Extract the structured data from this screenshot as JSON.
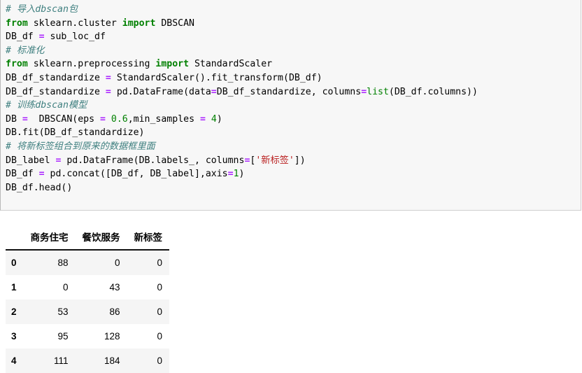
{
  "cell": {
    "code_lines": [
      [
        {
          "t": "comment",
          "s": "# 导入dbscan包"
        }
      ],
      [
        {
          "t": "kw",
          "s": "from"
        },
        {
          "t": "plain",
          "s": " sklearn.cluster "
        },
        {
          "t": "kw",
          "s": "import"
        },
        {
          "t": "plain",
          "s": " DBSCAN"
        }
      ],
      [
        {
          "t": "plain",
          "s": "DB_df "
        },
        {
          "t": "op",
          "s": "="
        },
        {
          "t": "plain",
          "s": " sub_loc_df"
        }
      ],
      [
        {
          "t": "comment",
          "s": "# 标准化"
        }
      ],
      [
        {
          "t": "kw",
          "s": "from"
        },
        {
          "t": "plain",
          "s": " sklearn.preprocessing "
        },
        {
          "t": "kw",
          "s": "import"
        },
        {
          "t": "plain",
          "s": " StandardScaler"
        }
      ],
      [
        {
          "t": "plain",
          "s": "DB_df_standardize "
        },
        {
          "t": "op",
          "s": "="
        },
        {
          "t": "plain",
          "s": " StandardScaler().fit_transform(DB_df)"
        }
      ],
      [
        {
          "t": "plain",
          "s": "DB_df_standardize "
        },
        {
          "t": "op",
          "s": "="
        },
        {
          "t": "plain",
          "s": " pd.DataFrame(data"
        },
        {
          "t": "op",
          "s": "="
        },
        {
          "t": "plain",
          "s": "DB_df_standardize, columns"
        },
        {
          "t": "op",
          "s": "="
        },
        {
          "t": "builtin",
          "s": "list"
        },
        {
          "t": "plain",
          "s": "(DB_df.columns))"
        }
      ],
      [
        {
          "t": "comment",
          "s": "# 训练dbscan模型"
        }
      ],
      [
        {
          "t": "plain",
          "s": "DB "
        },
        {
          "t": "op",
          "s": "="
        },
        {
          "t": "plain",
          "s": "  DBSCAN(eps "
        },
        {
          "t": "op",
          "s": "="
        },
        {
          "t": "plain",
          "s": " "
        },
        {
          "t": "num",
          "s": "0.6"
        },
        {
          "t": "plain",
          "s": ",min_samples "
        },
        {
          "t": "op",
          "s": "="
        },
        {
          "t": "plain",
          "s": " "
        },
        {
          "t": "num",
          "s": "4"
        },
        {
          "t": "plain",
          "s": ")"
        }
      ],
      [
        {
          "t": "plain",
          "s": "DB.fit(DB_df_standardize)"
        }
      ],
      [
        {
          "t": "comment",
          "s": "# 将新标签组合到原来的数据框里面"
        }
      ],
      [
        {
          "t": "plain",
          "s": "DB_label "
        },
        {
          "t": "op",
          "s": "="
        },
        {
          "t": "plain",
          "s": " pd.DataFrame(DB.labels_, columns"
        },
        {
          "t": "op",
          "s": "="
        },
        {
          "t": "plain",
          "s": "["
        },
        {
          "t": "str",
          "s": "'新标签'"
        },
        {
          "t": "plain",
          "s": "])"
        }
      ],
      [
        {
          "t": "plain",
          "s": "DB_df "
        },
        {
          "t": "op",
          "s": "="
        },
        {
          "t": "plain",
          "s": " pd.concat([DB_df, DB_label],axis"
        },
        {
          "t": "op",
          "s": "="
        },
        {
          "t": "num",
          "s": "1"
        },
        {
          "t": "plain",
          "s": ")"
        }
      ],
      [
        {
          "t": "plain",
          "s": "DB_df.head()"
        }
      ]
    ]
  },
  "output_table": {
    "index_header": "",
    "columns": [
      "商务住宅",
      "餐饮服务",
      "新标签"
    ],
    "index": [
      "0",
      "1",
      "2",
      "3",
      "4"
    ],
    "rows": [
      [
        "88",
        "0",
        "0"
      ],
      [
        "0",
        "43",
        "0"
      ],
      [
        "53",
        "86",
        "0"
      ],
      [
        "95",
        "128",
        "0"
      ],
      [
        "111",
        "184",
        "0"
      ]
    ]
  },
  "colors": {
    "cell_background": "#f7f7f7",
    "cell_border": "#cfcfcf",
    "comment": "#408080",
    "keyword": "#008000",
    "operator": "#aa22ff",
    "number": "#008000",
    "string": "#ba2121",
    "builtin": "#008000",
    "table_stripe": "#f5f5f5",
    "table_rule": "#111111"
  }
}
